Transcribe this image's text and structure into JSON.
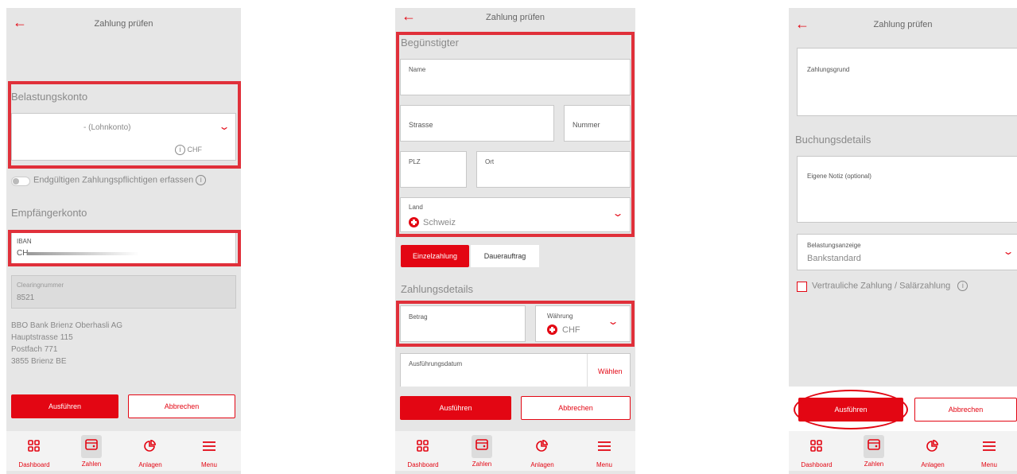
{
  "screen1": {
    "title": "Zahlung prüfen",
    "belastungskonto_label": "Belastungskonto",
    "account_value": "-  (Lohnkonto)",
    "currency": "CHF",
    "toggle_label": "Endgültigen Zahlungspflichtigen erfassen",
    "empfaengerkonto_label": "Empfängerkonto",
    "iban_label": "IBAN",
    "iban_prefix": "CH",
    "clearing_label": "Clearingnummer",
    "clearing_value": "8521",
    "bank_lines": [
      "BBO Bank Brienz Oberhasli AG",
      "Hauptstrasse 115",
      "Postfach 771",
      "3855 Brienz BE"
    ],
    "execute_label": "Ausführen",
    "cancel_label": "Abbrechen"
  },
  "screen2": {
    "title": "Zahlung prüfen",
    "beguenstigter_label": "Begünstigter",
    "name_label": "Name",
    "strasse_label": "Strasse",
    "nummer_label": "Nummer",
    "plz_label": "PLZ",
    "ort_label": "Ort",
    "land_label": "Land",
    "land_value": "Schweiz",
    "tab_single": "Einzelzahlung",
    "tab_standing": "Dauerauftrag",
    "zahlungsdetails_label": "Zahlungsdetails",
    "betrag_label": "Betrag",
    "waehrung_label": "Währung",
    "waehrung_value": "CHF",
    "datum_label": "Ausführungsdatum",
    "choose_label": "Wählen",
    "execute_label": "Ausführen",
    "cancel_label": "Abbrechen"
  },
  "screen3": {
    "title": "Zahlung prüfen",
    "zahlungsgrund_label": "Zahlungsgrund",
    "buchungsdetails_label": "Buchungsdetails",
    "notiz_label": "Eigene Notiz (optional)",
    "belastungsanzeige_label": "Belastungsanzeige",
    "belastungsanzeige_value": "Bankstandard",
    "confidential_label": "Vertrauliche Zahlung / Salärzahlung",
    "execute_label": "Ausführen",
    "cancel_label": "Abbrechen"
  },
  "nav": {
    "dashboard": "Dashboard",
    "zahlen": "Zahlen",
    "anlagen": "Anlagen",
    "menu": "Menu"
  },
  "icons": {
    "back": "back-arrow-icon",
    "chevron": "chevron-down-icon",
    "info": "info-icon",
    "swiss_flag": "swiss-flag-icon"
  },
  "colors": {
    "accent": "#e30613",
    "highlight": "#e0303a",
    "screen_bg": "#e6e6e6"
  }
}
